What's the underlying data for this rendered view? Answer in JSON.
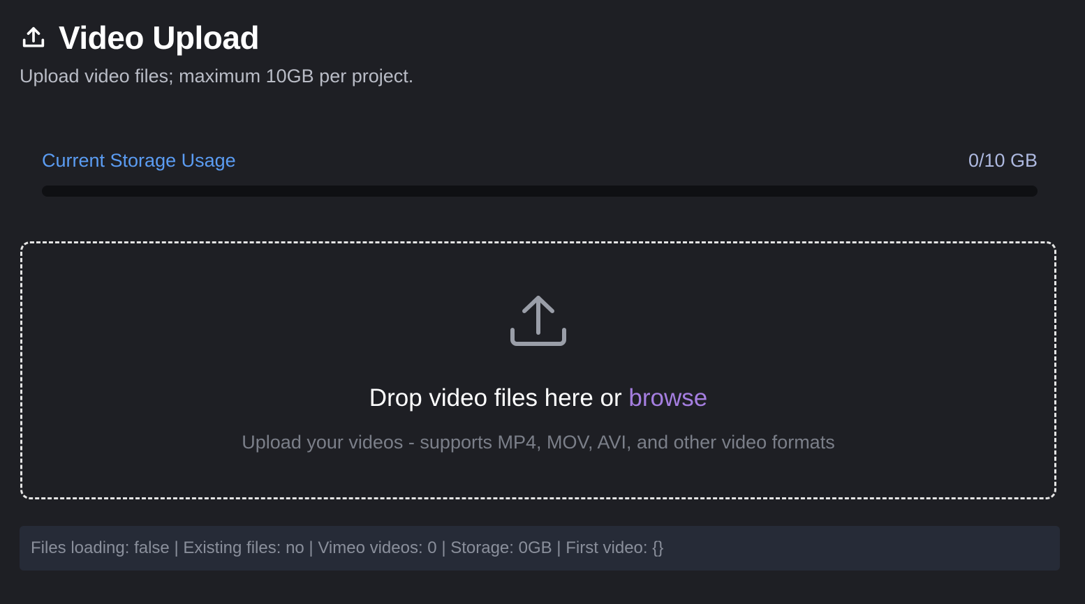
{
  "header": {
    "icon": "upload-icon",
    "title": "Video Upload",
    "subtitle": "Upload video files; maximum 10GB per project."
  },
  "storage": {
    "label": "Current Storage Usage",
    "value": "0/10 GB",
    "used_fraction": 0,
    "accent_color": "#5b9cf2"
  },
  "dropzone": {
    "icon": "upload-icon",
    "title_prefix": "Drop video files here or ",
    "browse_label": "browse",
    "browse_color": "#a57ee0",
    "subtitle": "Upload your videos - supports MP4, MOV, AVI, and other video formats"
  },
  "debug": {
    "text": "Files loading: false | Existing files: no | Vimeo videos: 0 | Storage: 0GB | First video: {}"
  }
}
